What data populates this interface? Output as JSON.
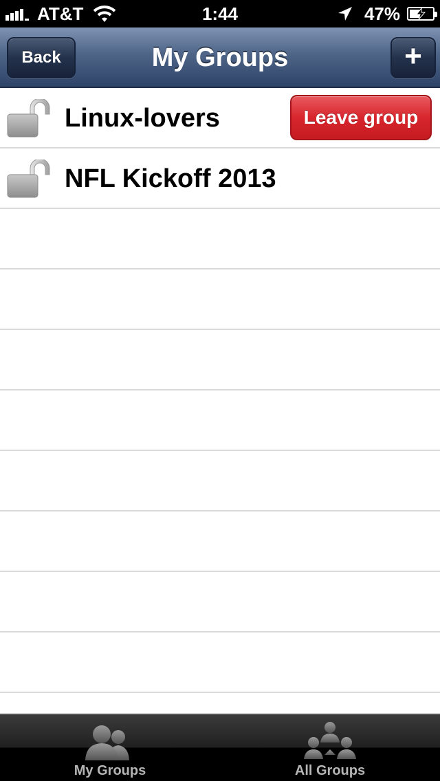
{
  "status_bar": {
    "carrier": "AT&T",
    "time": "1:44",
    "battery_percent": "47%",
    "battery_level": 0.47,
    "icons": [
      "signal-bars-icon",
      "wifi-icon",
      "location-arrow-icon",
      "battery-charging-icon"
    ]
  },
  "nav": {
    "title": "My Groups",
    "back_label": "Back",
    "add_label": "+"
  },
  "groups": [
    {
      "name": "Linux-lovers",
      "icon": "unlocked-padlock-icon",
      "action_label": "Leave group"
    },
    {
      "name": "NFL Kickoff 2013",
      "icon": "unlocked-padlock-icon"
    }
  ],
  "tab_bar": {
    "tabs": [
      {
        "label": "My Groups",
        "icon": "my-groups-icon"
      },
      {
        "label": "All Groups",
        "icon": "all-groups-icon"
      }
    ]
  },
  "colors": {
    "nav_blue": "#4e6588",
    "leave_red": "#d8262d",
    "separator": "#dadada"
  }
}
